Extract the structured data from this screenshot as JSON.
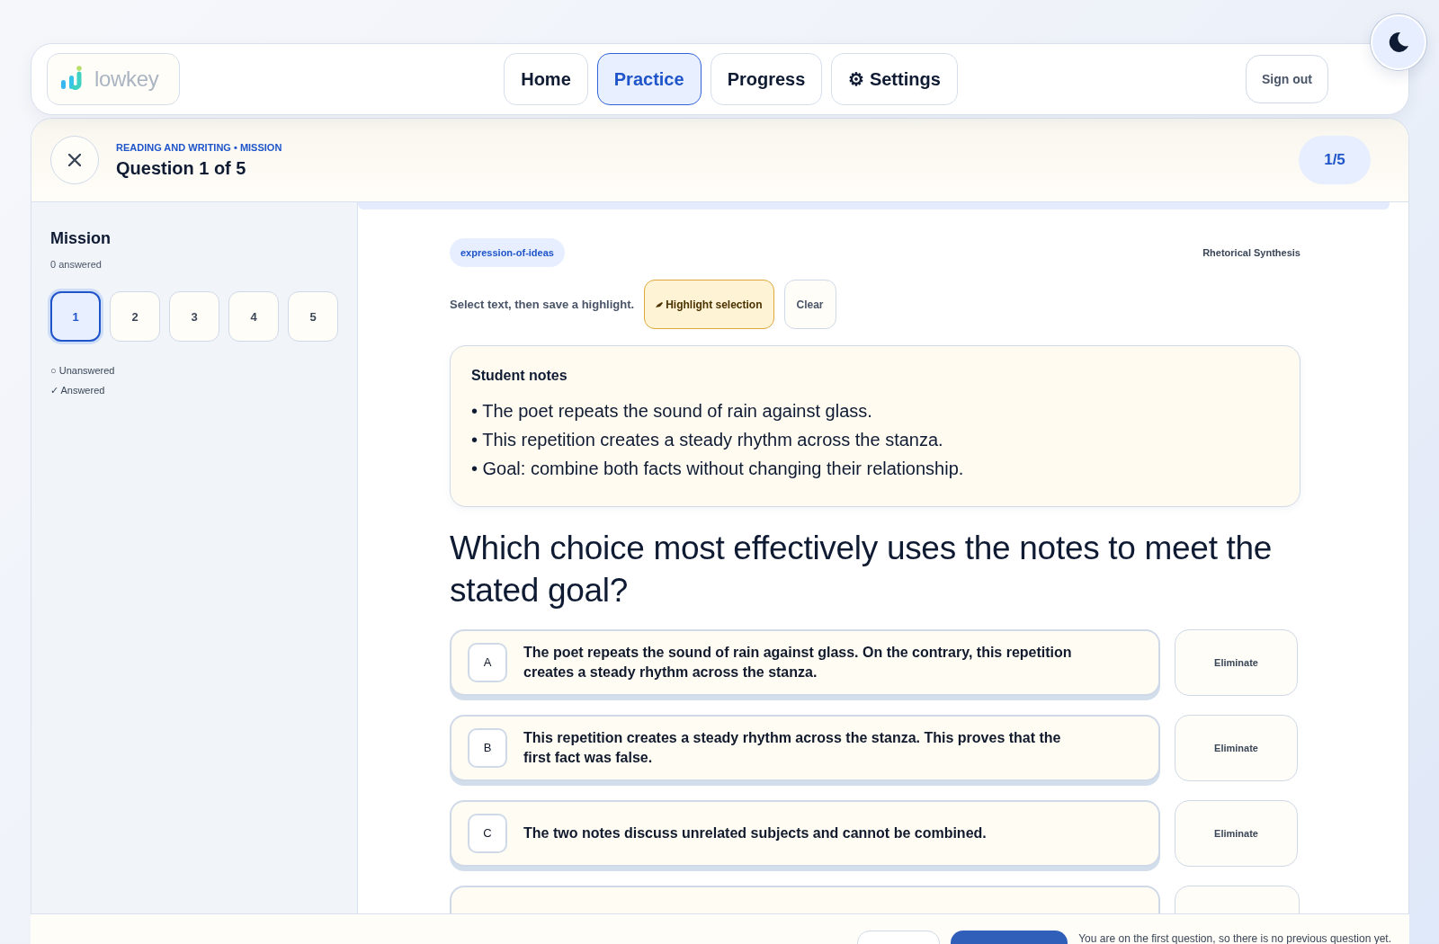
{
  "header": {
    "logo": "lowkey",
    "nav": [
      {
        "label": "Home",
        "selected": false
      },
      {
        "label": "Practice",
        "selected": true
      },
      {
        "label": "Progress",
        "selected": false
      },
      {
        "label": "⚙ Settings",
        "selected": false
      }
    ],
    "sign_out": "Sign out"
  },
  "question_header": {
    "breadcrumb": "READING AND WRITING • MISSION",
    "title": "Question 1 of 5",
    "counter": "1/5"
  },
  "sidebar": {
    "title": "Mission",
    "answered_count": "0 answered",
    "questions": [
      {
        "label": "1",
        "selected": true
      },
      {
        "label": "2",
        "selected": false
      },
      {
        "label": "3",
        "selected": false
      },
      {
        "label": "4",
        "selected": false
      },
      {
        "label": "5",
        "selected": false
      }
    ],
    "legend": [
      "○ Unanswered",
      "✓ Answered"
    ]
  },
  "progress": {
    "level": 1
  },
  "question": {
    "tag": "expression-of-ideas",
    "skill": "Rhetorical Synthesis",
    "highlight_hint": "Select text, then save a highlight.",
    "highlight_button": "Highlight selection",
    "clear_button": "Clear",
    "notes_title": "Student notes",
    "notes": [
      "• The poet repeats the sound of rain against glass.",
      "• This repetition creates a steady rhythm across the stanza.",
      "• Goal: combine both facts without changing their relationship."
    ],
    "prompt": "Which choice most effectively uses the notes to meet the stated goal?",
    "choices": [
      {
        "kind": "full",
        "letter": "A",
        "text": "The poet repeats the sound of rain against glass. On the contrary, this repetition creates a steady rhythm across the stanza.",
        "eliminate": "Eliminate"
      },
      {
        "kind": "full",
        "letter": "B",
        "text": "This repetition creates a steady rhythm across the stanza. This proves that the first fact was false.",
        "eliminate": "Eliminate"
      },
      {
        "kind": "full",
        "letter": "C",
        "text": "The two notes discuss unrelated subjects and cannot be combined.",
        "eliminate": "Eliminate"
      },
      {
        "kind": "partial"
      }
    ]
  },
  "footer": {
    "message": "You are on the first question, so there is no previous question yet."
  }
}
